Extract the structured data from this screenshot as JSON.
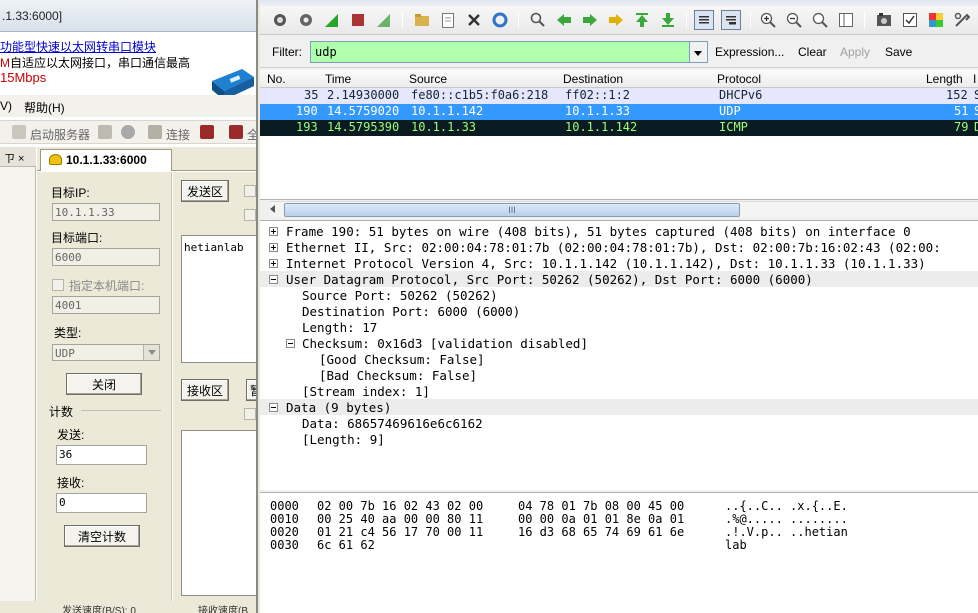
{
  "left_app": {
    "title": ".1.33:6000]",
    "ad": {
      "line1": "功能型快速以太网转串口模块",
      "line2_mark": "M",
      "line2": "自适应以太网接口，串口通信最高",
      "line3": "15Mbps"
    },
    "menu": [
      {
        "label": "V)"
      },
      {
        "label": "帮助(H)"
      }
    ],
    "toolbar": {
      "start_server": "启动服务器",
      "connect": "连接",
      "all": "全"
    },
    "side_header": "ㄗ ×",
    "tab": {
      "label": "10.1.1.33:6000"
    },
    "form": {
      "target_ip_label": "目标IP:",
      "target_ip": "10.1.1.33",
      "target_port_label": "目标端口:",
      "target_port": "6000",
      "local_port_label": "指定本机端口:",
      "local_port": "4001",
      "type_label": "类型:",
      "type_value": "UDP",
      "close_button": "关闭",
      "count_label": "计数",
      "send_label": "发送:",
      "send_count": "36",
      "recv_label": "接收:",
      "recv_count": "0",
      "clear_button": "清空计数"
    },
    "send_area": {
      "button": "发送区",
      "content": "hetianlab"
    },
    "recv_area": {
      "button": "接收区",
      "extra": "暂"
    },
    "status": {
      "send_speed": "发送速度(B/S): 0",
      "recv_speed": "接收速度(B"
    }
  },
  "wireshark": {
    "filter": {
      "label": "Filter:",
      "value": "udp",
      "expression": "Expression...",
      "clear": "Clear",
      "apply": "Apply",
      "save": "Save"
    },
    "columns": {
      "no": "No.",
      "time": "Time",
      "source": "Source",
      "destination": "Destination",
      "protocol": "Protocol",
      "length": "Length",
      "info": "I"
    },
    "packets": [
      {
        "no": "35",
        "time": "2.14930000",
        "source": "fe80::c1b5:f0a6:218",
        "destination": "ff02::1:2",
        "protocol": "DHCPv6",
        "length": "152",
        "info": "S"
      },
      {
        "no": "190",
        "time": "14.5759020",
        "source": "10.1.1.142",
        "destination": "10.1.1.33",
        "protocol": "UDP",
        "length": "51",
        "info": "S"
      },
      {
        "no": "193",
        "time": "14.5795390",
        "source": "10.1.1.33",
        "destination": "10.1.1.142",
        "protocol": "ICMP",
        "length": "79",
        "info": "D"
      }
    ],
    "scroll_grip": "III",
    "details": [
      {
        "text": "Frame 190: 51 bytes on wire (408 bits), 51 bytes captured (408 bits) on interface 0",
        "expander": "plus"
      },
      {
        "text": "Ethernet II, Src: 02:00:04:78:01:7b (02:00:04:78:01:7b), Dst: 02:00:7b:16:02:43 (02:00:",
        "expander": "plus"
      },
      {
        "text": "Internet Protocol Version 4, Src: 10.1.1.142 (10.1.1.142), Dst: 10.1.1.33 (10.1.1.33)",
        "expander": "plus"
      },
      {
        "text": "User Datagram Protocol, Src Port: 50262 (50262), Dst Port: 6000 (6000)",
        "expander": "minus"
      },
      {
        "text": "Source Port: 50262 (50262)",
        "expander": "none"
      },
      {
        "text": "Destination Port: 6000 (6000)",
        "expander": "none"
      },
      {
        "text": "Length: 17",
        "expander": "none"
      },
      {
        "text": "Checksum: 0x16d3 [validation disabled]",
        "expander": "minus"
      },
      {
        "text": "[Good Checksum: False]",
        "expander": "none"
      },
      {
        "text": "[Bad Checksum: False]",
        "expander": "none"
      },
      {
        "text": "[Stream index: 1]",
        "expander": "none"
      },
      {
        "text": "Data (9 bytes)",
        "expander": "minus"
      },
      {
        "text": "Data: 68657469616e6c6162",
        "expander": "none"
      },
      {
        "text": "[Length: 9]",
        "expander": "none"
      }
    ],
    "bytes": [
      {
        "offset": "0000",
        "hex1": "02 00 7b 16 02 43 02 00",
        "hex2": "04 78 01 7b 08 00 45 00",
        "ascii": "..{..C.. .x.{..E."
      },
      {
        "offset": "0010",
        "hex1": "00 25 40 aa 00 00 80 11",
        "hex2": "00 00 0a 01 01 8e 0a 01",
        "ascii": ".%@..... ........"
      },
      {
        "offset": "0020",
        "hex1": "01 21 c4 56 17 70 00 11",
        "hex2": "16 d3 68 65 74 69 61 6e",
        "ascii": ".!.V.p.. ..hetian"
      },
      {
        "offset": "0030",
        "hex1": "6c 61 62",
        "hex2": "",
        "ascii": "lab"
      }
    ],
    "colors": {
      "filter_ok": "#afffaf",
      "row_dhcpv6": "#e7e6ff",
      "row_selected": "#3399ff",
      "row_icmp_bg": "#0b1b22",
      "row_icmp_fg": "#9cff7a"
    }
  }
}
